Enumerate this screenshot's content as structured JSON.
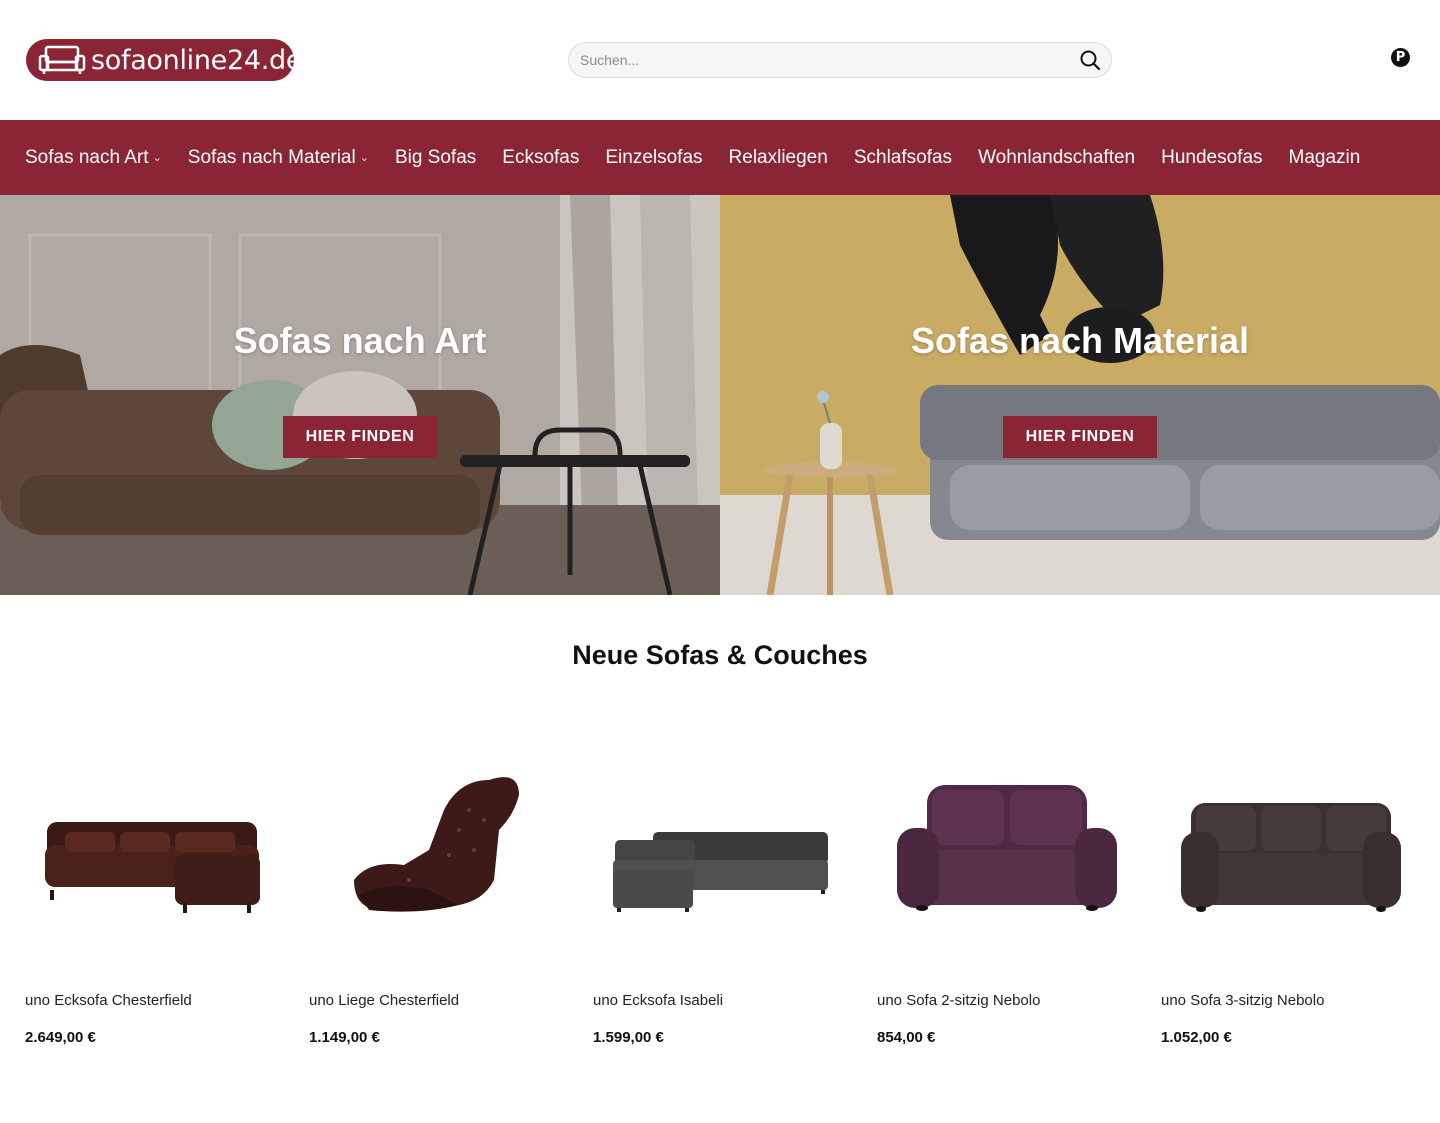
{
  "header": {
    "logo_text": "sofaonline24.de",
    "search_placeholder": "Suchen...",
    "social_icon": "pinterest-icon"
  },
  "nav": {
    "items": [
      {
        "label": "Sofas nach Art",
        "has_dropdown": true
      },
      {
        "label": "Sofas nach Material",
        "has_dropdown": true
      },
      {
        "label": "Big Sofas"
      },
      {
        "label": "Ecksofas"
      },
      {
        "label": "Einzelsofas"
      },
      {
        "label": "Relaxliegen"
      },
      {
        "label": "Schlafsofas"
      },
      {
        "label": "Wohnlandschaften"
      },
      {
        "label": "Hundesofas"
      },
      {
        "label": "Magazin"
      }
    ]
  },
  "hero": {
    "left": {
      "title": "Sofas nach Art",
      "button": "HIER FINDEN"
    },
    "right": {
      "title": "Sofas nach Material",
      "button": "HIER FINDEN"
    }
  },
  "section": {
    "title": "Neue Sofas & Couches"
  },
  "products": [
    {
      "name": "uno Ecksofa Chesterfield",
      "price": "2.649,00 €"
    },
    {
      "name": "uno Liege Chesterfield",
      "price": "1.149,00 €"
    },
    {
      "name": "uno Ecksofa Isabeli",
      "price": "1.599,00 €"
    },
    {
      "name": "uno Sofa 2-sitzig Nebolo",
      "price": "854,00 €"
    },
    {
      "name": "uno Sofa 3-sitzig Nebolo",
      "price": "1.052,00 €"
    }
  ],
  "colors": {
    "brand": "#8b2535",
    "text": "#111111"
  }
}
